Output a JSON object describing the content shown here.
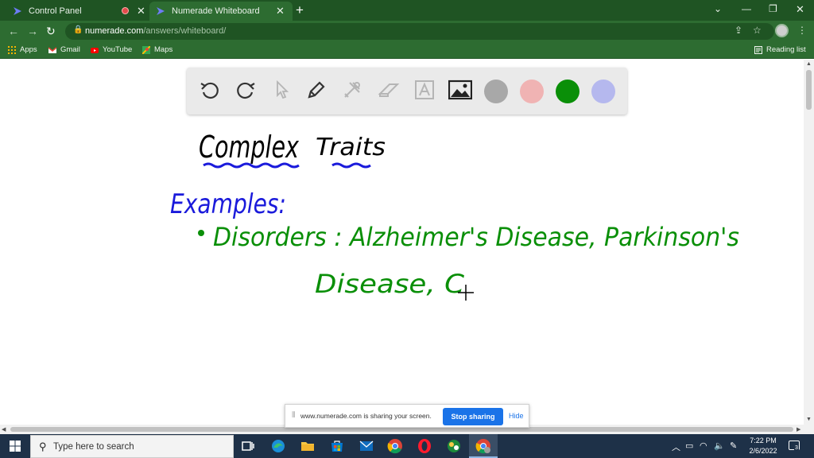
{
  "tabs": [
    {
      "label": "Control Panel"
    },
    {
      "label": "Numerade Whiteboard"
    }
  ],
  "address": {
    "host": "numerade.com",
    "path": "/answers/whiteboard/"
  },
  "bookmarks": {
    "items": [
      {
        "label": "Apps"
      },
      {
        "label": "Gmail"
      },
      {
        "label": "YouTube"
      },
      {
        "label": "Maps"
      }
    ],
    "reading_list": "Reading list"
  },
  "whiteboard": {
    "tools": [
      "undo-icon",
      "redo-icon",
      "pointer-icon",
      "pen-icon",
      "tools-icon",
      "eraser-icon",
      "text-icon",
      "image-icon"
    ],
    "colors": [
      "#a8a8a8",
      "#f0b3b3",
      "#0a8f08",
      "#b5b8ee"
    ],
    "handwriting": {
      "title_word1": "Complex",
      "title_word2": "Traits",
      "examples": "Examples:",
      "line1": "Disorders : Alzheimer's Disease, Parkinson's",
      "line2": "Disease, C"
    },
    "ink_colors": {
      "title": "#000000",
      "underline": "#1a1adb",
      "heading": "#1a1adb",
      "body": "#0a8f08"
    }
  },
  "sharing": {
    "message": "www.numerade.com is sharing your screen.",
    "stop_label": "Stop sharing",
    "hide_label": "Hide"
  },
  "taskbar": {
    "search_placeholder": "Type here to search",
    "time": "7:22 PM",
    "date": "2/6/2022",
    "notifications": "3"
  }
}
